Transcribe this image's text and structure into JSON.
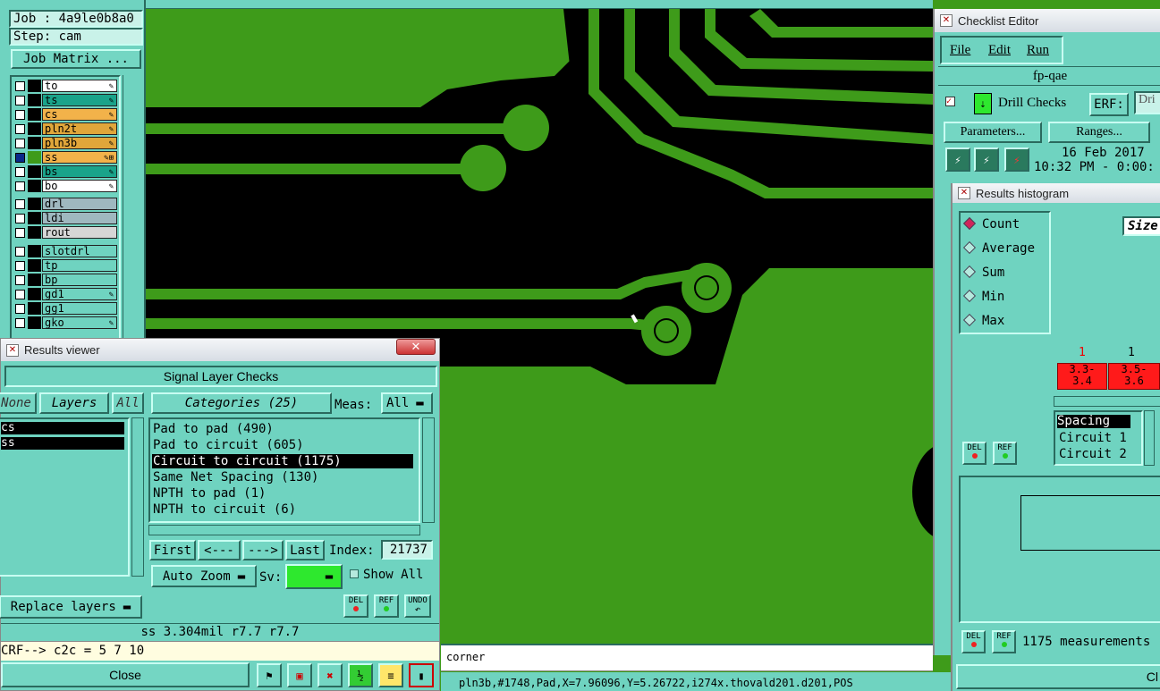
{
  "job_panel": {
    "job": "Job : 4a9le0b8a0",
    "step": "Step: cam",
    "job_matrix": "Job Matrix ...",
    "layers_group1": [
      {
        "name": "to",
        "color": "#ffffff",
        "edit": "✎",
        "selected": false
      },
      {
        "name": "ts",
        "color": "#1aa38a",
        "edit": "✎",
        "selected": false
      },
      {
        "name": "cs",
        "color": "#f2b24a",
        "edit": "✎",
        "selected": false
      },
      {
        "name": "pln2t",
        "color": "#e0a63a",
        "edit": "✎",
        "selected": false
      },
      {
        "name": "pln3b",
        "color": "#e0a63a",
        "edit": "✎",
        "selected": false
      },
      {
        "name": "ss",
        "color": "#f2b24a",
        "edit": "✎⊞",
        "selected": true
      },
      {
        "name": "bs",
        "color": "#1aa38a",
        "edit": "✎",
        "selected": false
      },
      {
        "name": "bo",
        "color": "#ffffff",
        "edit": "✎",
        "selected": false
      }
    ],
    "layers_group2": [
      {
        "name": "drl",
        "color": "#9fb8bf"
      },
      {
        "name": "ldi",
        "color": "#9fb8bf"
      },
      {
        "name": "rout",
        "color": "#d6d6d6"
      }
    ],
    "layers_group3": [
      {
        "name": "slotdrl",
        "edit": ""
      },
      {
        "name": "tp",
        "edit": ""
      },
      {
        "name": "bp",
        "edit": ""
      },
      {
        "name": "gd1",
        "edit": "✎"
      },
      {
        "name": "gg1",
        "edit": ""
      },
      {
        "name": "gko",
        "edit": "✎"
      }
    ]
  },
  "results_viewer": {
    "window_title": "Results viewer",
    "heading": "Signal Layer Checks",
    "none_btn": "None",
    "layers_btn": "Layers",
    "all_btn": "All",
    "categories_btn": "Categories (25)",
    "meas_label": "Meas:",
    "meas_value": "All",
    "layer_list": [
      "cs",
      "ss"
    ],
    "categories": [
      "Pad to pad (490)",
      "Pad to circuit (605)",
      "Circuit to circuit (1175)",
      "Same Net Spacing (130)",
      "NPTH to pad (1)",
      "NPTH to circuit (6)"
    ],
    "selected_category": 2,
    "first": "First",
    "prev": "<---",
    "next": "--->",
    "last": "Last",
    "index_label": "Index:",
    "index_value": "21737",
    "auto_zoom": "Auto Zoom",
    "sv_label": "Sv:",
    "show_all": "Show All",
    "replace_layers": "Replace layers",
    "del": "DEL",
    "ref": "REF",
    "undo": "UNDO",
    "status": "ss 3.304mil   r7.7   r7.7",
    "erf_line": "CRF--> c2c = 5 7 10",
    "close": "Close"
  },
  "canvas_status": {
    "corner": "corner",
    "coords": "pln3b,#1748,Pad,X=7.96096,Y=5.26722,i274x.thovald201.d201,POS"
  },
  "checklist_editor": {
    "window_title": "Checklist Editor",
    "menu": [
      "File",
      "Edit",
      "Run"
    ],
    "name": "fp-qae",
    "drill_checks": "Drill Checks",
    "erf_label": "ERF:",
    "erf_value": "Dri",
    "parameters": "Parameters...",
    "ranges": "Ranges...",
    "date": "16 Feb 2017",
    "time": "10:32 PM - 0:00:"
  },
  "histogram": {
    "window_title": "Results histogram",
    "options": [
      "Count",
      "Average",
      "Sum",
      "Min",
      "Max"
    ],
    "selected": "Count",
    "size_label": "Size",
    "counts": [
      "1",
      "1"
    ],
    "bins": [
      "3.3-\n3.4",
      "3.5-\n3.6"
    ],
    "list": [
      "Spacing",
      "Circuit 1",
      "Circuit 2"
    ],
    "measurements": "1175 measurements",
    "close": "Cl"
  },
  "colors": {
    "panel": "#6fd3c0",
    "copper": "#3e9b1a",
    "bin": "#ff1a1a",
    "sv": "#2ee82e"
  }
}
